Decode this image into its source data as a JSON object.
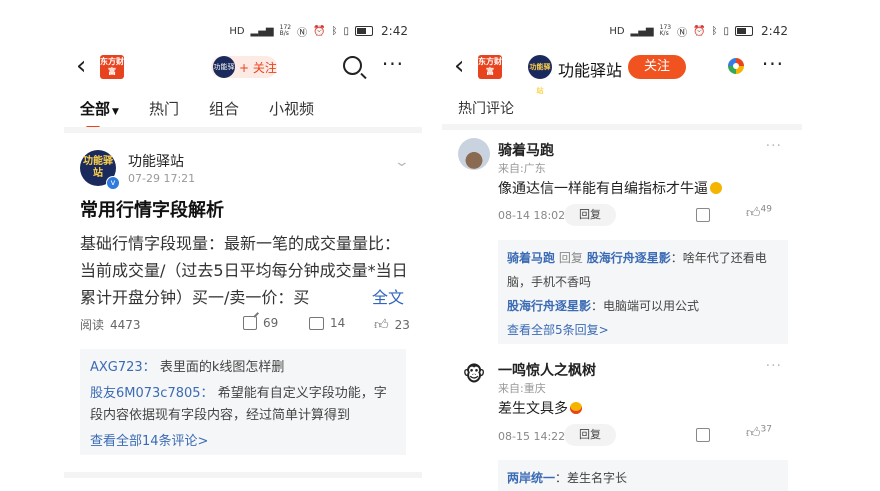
{
  "left": {
    "status": {
      "net_top": "172",
      "net_bottom": "B/s",
      "time": "2:42"
    },
    "header": {
      "logo_text": "东方财富",
      "avatar_text": "功能驿站",
      "follow_label": "+ 关注"
    },
    "tabs": [
      {
        "label": "全部"
      },
      {
        "label": "热门"
      },
      {
        "label": "组合"
      },
      {
        "label": "小视频"
      }
    ],
    "post": {
      "author": "功能驿站",
      "avatar_text": "功能驿站",
      "date": "07-29 17:21",
      "title": "常用行情字段解析",
      "body": "基础行情字段现量：最新一笔的成交量量比：当前成交量/（过去5日平均每分钟成交量*当日累计开盘分钟）买一/卖一价：买",
      "full_text_label": "全文",
      "read_label": "阅读",
      "read_count": "4473",
      "share_count": "69",
      "comment_count": "14",
      "like_count": "23"
    },
    "comments_preview": [
      {
        "name": "AXG723：",
        "text": "表里面的k线图怎样删"
      },
      {
        "name": "股友6M073c7805：",
        "text": "希望能有自定义字段功能，字段内容依据现有字段内容，经过简单计算得到"
      }
    ],
    "view_all": "查看全部14条评论>"
  },
  "right": {
    "status": {
      "net_top": "173",
      "net_bottom": "K/s",
      "time": "2:42"
    },
    "header": {
      "logo_text": "东方财富",
      "avatar_text": "功能驿站",
      "name": "功能驿站",
      "follow_label": "关注"
    },
    "section_title": "热门评论",
    "comments": [
      {
        "name": "骑着马跑",
        "location": "来自:广东",
        "text": "像通达信一样能有自编指标才牛逼",
        "date": "08-14 18:02",
        "reply_label": "回复",
        "likes": "49",
        "replies": [
          {
            "author": "骑着马跑",
            "reply_word": "回复",
            "target": "股海行舟逐星影",
            "text": "：啥年代了还看电脑，手机不香吗"
          },
          {
            "author": "股海行舟逐星影",
            "text": "：电脑端可以用公式"
          }
        ],
        "view_replies": "查看全部5条回复>"
      },
      {
        "name": "一鸣惊人之枫树",
        "location": "来自:重庆",
        "text": "差生文具多",
        "date": "08-15 14:22",
        "reply_label": "回复",
        "likes": "37",
        "replies": [
          {
            "author": "两岸统一",
            "text": "：差生名字长"
          }
        ]
      }
    ]
  }
}
